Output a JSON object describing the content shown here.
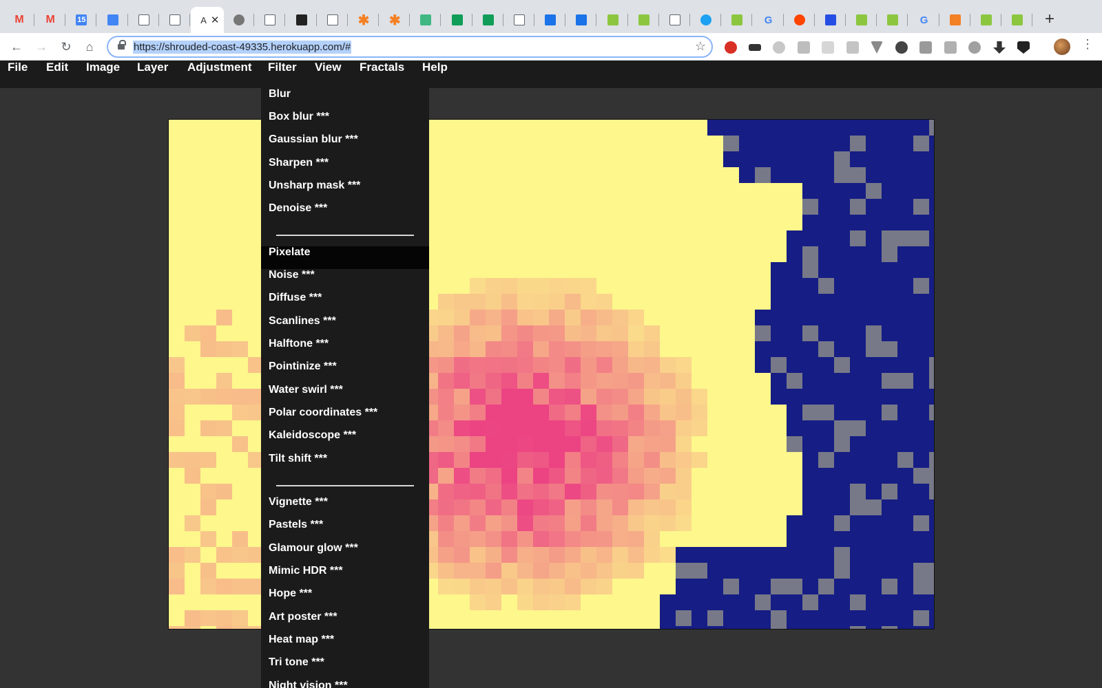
{
  "browser": {
    "address": "https://shrouded-coast-49335.herokuapp.com/#",
    "active_tab_title": "A",
    "tab_favicons": [
      "gmail-icon",
      "gmail-icon",
      "calendar-icon",
      "docs-icon",
      "page-icon",
      "page-icon",
      "active",
      "aperture-icon",
      "page-icon",
      "codepen-icon",
      "page-icon",
      "asterisk-icon",
      "asterisk-icon",
      "vue-icon",
      "sheets-icon",
      "sheets-icon",
      "page-icon",
      "shield-icon",
      "shield-icon",
      "w3-icon",
      "w3-icon",
      "page-icon",
      "bird-icon",
      "w3-icon",
      "google-icon",
      "reddit-icon",
      "css3-icon",
      "w3-icon",
      "w3-icon",
      "google-icon",
      "stackoverflow-icon",
      "w3-icon",
      "w3-icon"
    ],
    "calendar_badge": "15",
    "new_tab": "+"
  },
  "menubar": {
    "items": [
      "File",
      "Edit",
      "Image",
      "Layer",
      "Adjustment",
      "Filter",
      "View",
      "Fractals",
      "Help"
    ]
  },
  "filter_menu": {
    "group1": [
      "Blur",
      "Box blur ***",
      "Gaussian blur ***",
      "Sharpen ***",
      "Unsharp mask ***",
      "Denoise ***"
    ],
    "group2": [
      "Pixelate",
      "Noise ***",
      "Diffuse ***",
      "Scanlines ***",
      "Halftone ***",
      "Pointinize ***",
      "Water swirl ***",
      "Polar coordinates ***",
      "Kaleidoscope ***",
      "Tilt shift ***"
    ],
    "group3": [
      "Vignette ***",
      "Pastels ***",
      "Glamour glow ***",
      "Mimic HDR ***",
      "Hope ***",
      "Art poster ***",
      "Heat map ***",
      "Tri tone ***",
      "Night vision ***"
    ],
    "hovered": "Pixelate"
  },
  "colors": {
    "menubar_bg": "#1b1b1b",
    "workspace_bg": "#333333",
    "canvas_yellow": "#fdf78c",
    "canvas_pink": "#ec4383",
    "canvas_navy": "#0a1284"
  }
}
